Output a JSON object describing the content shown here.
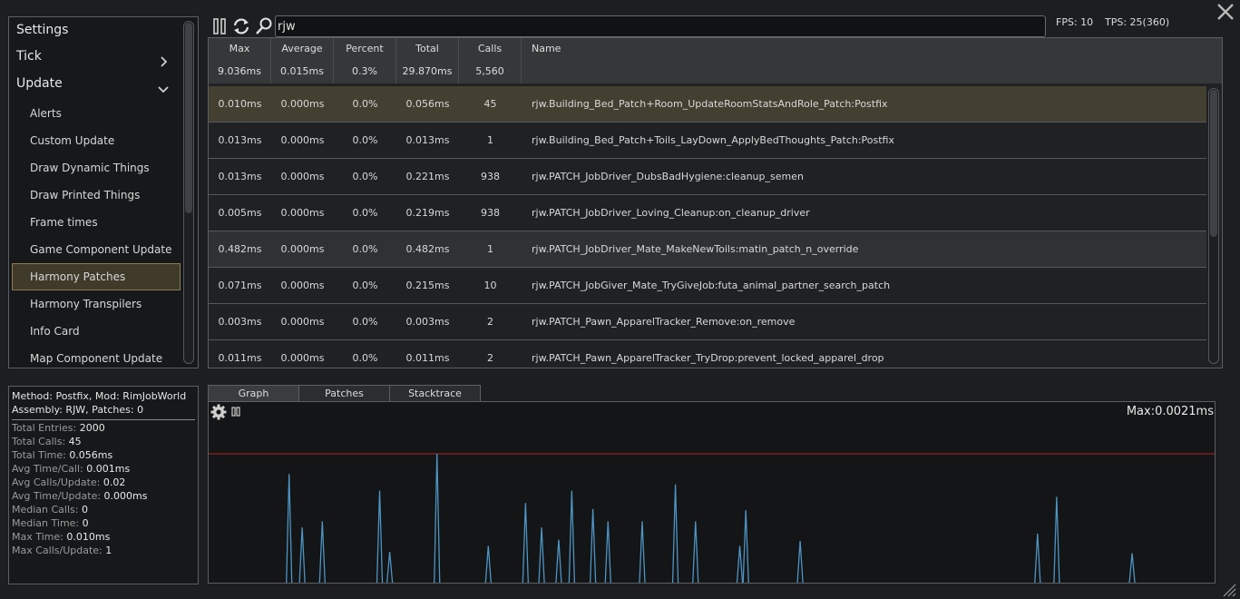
{
  "categories": {
    "top": [
      {
        "label": "Settings",
        "chevron": null
      },
      {
        "label": "Tick",
        "chevron": "right"
      },
      {
        "label": "Update",
        "chevron": "down"
      }
    ],
    "sub": [
      "Alerts",
      "Custom Update",
      "Draw Dynamic Things",
      "Draw Printed Things",
      "Frame times",
      "Game Component Update",
      "Harmony Patches",
      "Harmony Transpilers",
      "Info Card",
      "Map Component Update"
    ],
    "selected_index": 6
  },
  "toolbar": {
    "search_value": "rjw",
    "fps": "FPS: 10",
    "tps": "TPS: 25(360)"
  },
  "table": {
    "columns": [
      {
        "title": "Max",
        "value": "9.036ms"
      },
      {
        "title": "Average",
        "value": "0.015ms"
      },
      {
        "title": "Percent",
        "value": "0.3%"
      },
      {
        "title": "Total",
        "value": "29.870ms"
      },
      {
        "title": "Calls",
        "value": "5,560"
      },
      {
        "title": "Name",
        "value": ""
      }
    ],
    "rows": [
      [
        "0.010ms",
        "0.000ms",
        "0.0%",
        "0.056ms",
        "45",
        "rjw.Building_Bed_Patch+Room_UpdateRoomStatsAndRole_Patch:Postfix"
      ],
      [
        "0.013ms",
        "0.000ms",
        "0.0%",
        "0.013ms",
        "1",
        "rjw.Building_Bed_Patch+Toils_LayDown_ApplyBedThoughts_Patch:Postfix"
      ],
      [
        "0.013ms",
        "0.000ms",
        "0.0%",
        "0.221ms",
        "938",
        "rjw.PATCH_JobDriver_DubsBadHygiene:cleanup_semen"
      ],
      [
        "0.005ms",
        "0.000ms",
        "0.0%",
        "0.219ms",
        "938",
        "rjw.PATCH_JobDriver_Loving_Cleanup:on_cleanup_driver"
      ],
      [
        "0.482ms",
        "0.000ms",
        "0.0%",
        "0.482ms",
        "1",
        "rjw.PATCH_JobDriver_Mate_MakeNewToils:matin_patch_n_override"
      ],
      [
        "0.071ms",
        "0.000ms",
        "0.0%",
        "0.215ms",
        "10",
        "rjw.PATCH_JobGiver_Mate_TryGiveJob:futa_animal_partner_search_patch"
      ],
      [
        "0.003ms",
        "0.000ms",
        "0.0%",
        "0.003ms",
        "2",
        "rjw.PATCH_Pawn_ApparelTracker_Remove:on_remove"
      ],
      [
        "0.011ms",
        "0.000ms",
        "0.0%",
        "0.011ms",
        "2",
        "rjw.PATCH_Pawn_ApparelTracker_TryDrop:prevent_locked_apparel_drop"
      ]
    ],
    "selected_row": 0,
    "hover_row": 4
  },
  "details": {
    "header_line1": "Method: Postfix, Mod: RimJobWorld",
    "header_line2": "Assembly: RJW, Patches: 0",
    "stats": [
      {
        "label": "Total Entries: ",
        "value": "2000"
      },
      {
        "label": "Total Calls: ",
        "value": "45"
      },
      {
        "label": "Total Time: ",
        "value": "0.056ms"
      },
      {
        "label": "Avg Time/Call: ",
        "value": "0.001ms"
      },
      {
        "label": "Avg Calls/Update: ",
        "value": "0.02"
      },
      {
        "label": "Avg Time/Update: ",
        "value": "0.000ms"
      },
      {
        "label": "Median Calls: ",
        "value": "0"
      },
      {
        "label": "Median Time: ",
        "value": "0"
      },
      {
        "label": "Max Time: ",
        "value": "0.010ms"
      },
      {
        "label": "Max Calls/Update: ",
        "value": "1"
      }
    ]
  },
  "tabs": [
    "Graph",
    "Patches",
    "Stacktrace"
  ],
  "active_tab": 0,
  "graph": {
    "max_label": "Max:0.0021ms",
    "colors": {
      "line": "#4d94c4",
      "max_line": "#b52222"
    }
  },
  "chart_data": {
    "type": "line",
    "title": "Max:0.0021ms",
    "ylim": [
      0,
      0.0021
    ],
    "max_line": 0.0021,
    "spikes": [
      {
        "x": 0.08,
        "y": 0.00177
      },
      {
        "x": 0.093,
        "y": 0.0009
      },
      {
        "x": 0.113,
        "y": 0.001
      },
      {
        "x": 0.17,
        "y": 0.0015
      },
      {
        "x": 0.18,
        "y": 0.0005
      },
      {
        "x": 0.227,
        "y": 0.0021
      },
      {
        "x": 0.278,
        "y": 0.0006
      },
      {
        "x": 0.315,
        "y": 0.0013
      },
      {
        "x": 0.331,
        "y": 0.0009
      },
      {
        "x": 0.348,
        "y": 0.0007
      },
      {
        "x": 0.361,
        "y": 0.0015
      },
      {
        "x": 0.382,
        "y": 0.0012
      },
      {
        "x": 0.397,
        "y": 0.001
      },
      {
        "x": 0.431,
        "y": 0.001
      },
      {
        "x": 0.464,
        "y": 0.0016
      },
      {
        "x": 0.484,
        "y": 0.001
      },
      {
        "x": 0.528,
        "y": 0.0006
      },
      {
        "x": 0.534,
        "y": 0.00118
      },
      {
        "x": 0.588,
        "y": 0.00068
      },
      {
        "x": 0.824,
        "y": 0.0008
      },
      {
        "x": 0.843,
        "y": 0.0014
      },
      {
        "x": 0.918,
        "y": 0.00048
      }
    ]
  }
}
